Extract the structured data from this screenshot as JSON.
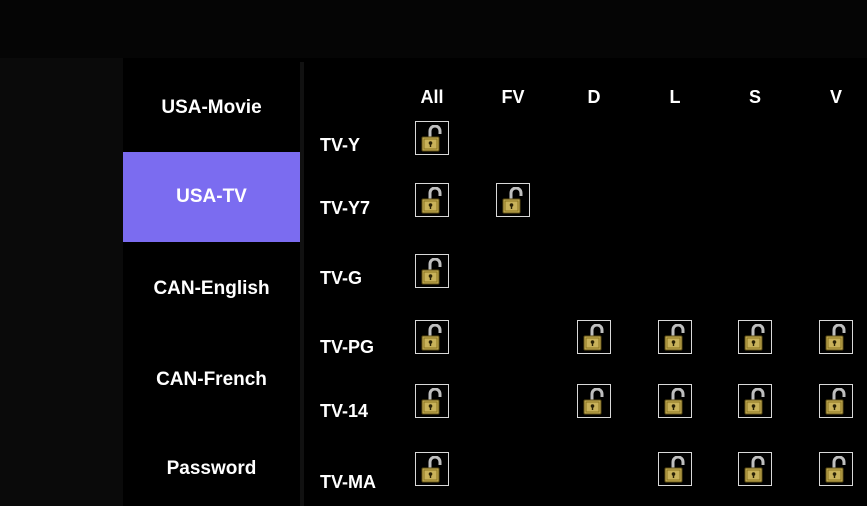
{
  "sidebar": {
    "items": [
      {
        "label": "USA-Movie",
        "selected": false
      },
      {
        "label": "USA-TV",
        "selected": true
      },
      {
        "label": "CAN-English",
        "selected": false
      },
      {
        "label": "CAN-French",
        "selected": false
      },
      {
        "label": "Password",
        "selected": false
      }
    ]
  },
  "grid": {
    "columns": [
      "All",
      "FV",
      "D",
      "L",
      "S",
      "V"
    ],
    "rows": [
      {
        "label": "TV-Y",
        "locks": [
          "All"
        ]
      },
      {
        "label": "TV-Y7",
        "locks": [
          "All",
          "FV"
        ]
      },
      {
        "label": "TV-G",
        "locks": [
          "All"
        ]
      },
      {
        "label": "TV-PG",
        "locks": [
          "All",
          "D",
          "L",
          "S",
          "V"
        ]
      },
      {
        "label": "TV-14",
        "locks": [
          "All",
          "D",
          "L",
          "S",
          "V"
        ]
      },
      {
        "label": "TV-MA",
        "locks": [
          "All",
          "L",
          "S",
          "V"
        ]
      }
    ],
    "lock_state": "unlocked",
    "icon": "unlocked-padlock-icon"
  },
  "colors": {
    "selected_bg": "#7b6cf0",
    "lock_body": "#c9b25a"
  }
}
